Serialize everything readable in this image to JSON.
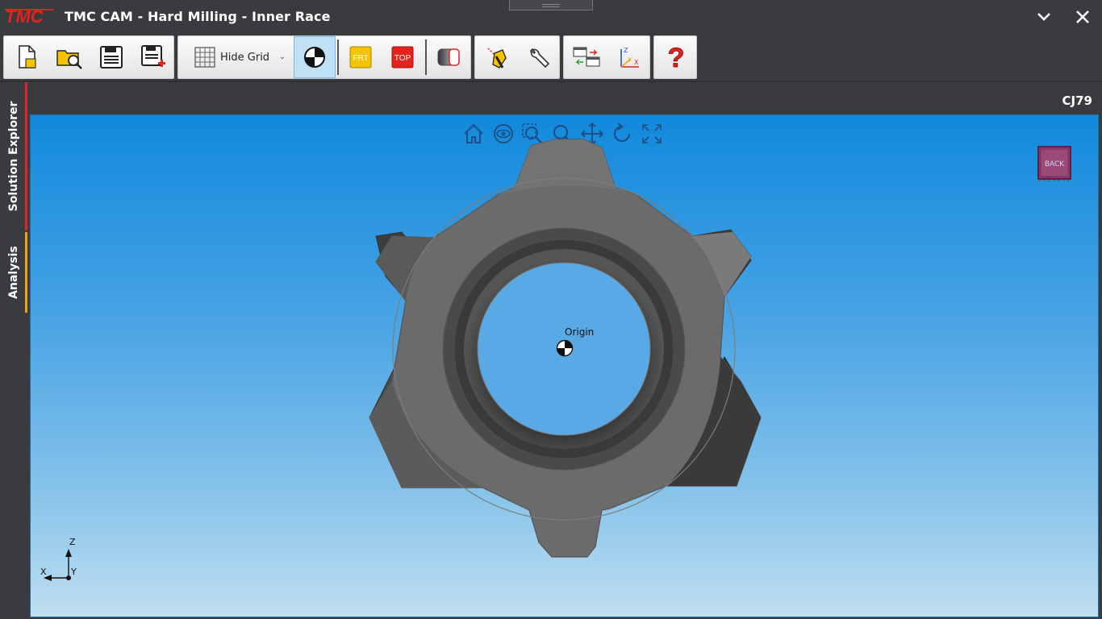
{
  "app": {
    "logo_text": "TMC",
    "title": "TMC CAM - Hard Milling - Inner Race"
  },
  "toolbar": {
    "hide_grid_label": "Hide Grid",
    "front_view_label": "FRT",
    "top_view_label": "TOP"
  },
  "sidebar": {
    "tabs": [
      {
        "label": "Solution Explorer"
      },
      {
        "label": "Analysis"
      }
    ]
  },
  "viewport": {
    "code": "CJ79",
    "origin_label": "Origin",
    "view_cube_label": "BACK",
    "axes": {
      "z": "Z",
      "x": "X",
      "y": "Y"
    }
  },
  "colors": {
    "background": "#3a3b3f",
    "logo_red": "#e3231c",
    "explorer_tab_bar": "#d6282a",
    "analysis_tab_bar": "#e8a317",
    "viewport_top": "#1189dc",
    "viewport_bottom": "#c0def0",
    "part_gray": "#6b6b6b"
  }
}
